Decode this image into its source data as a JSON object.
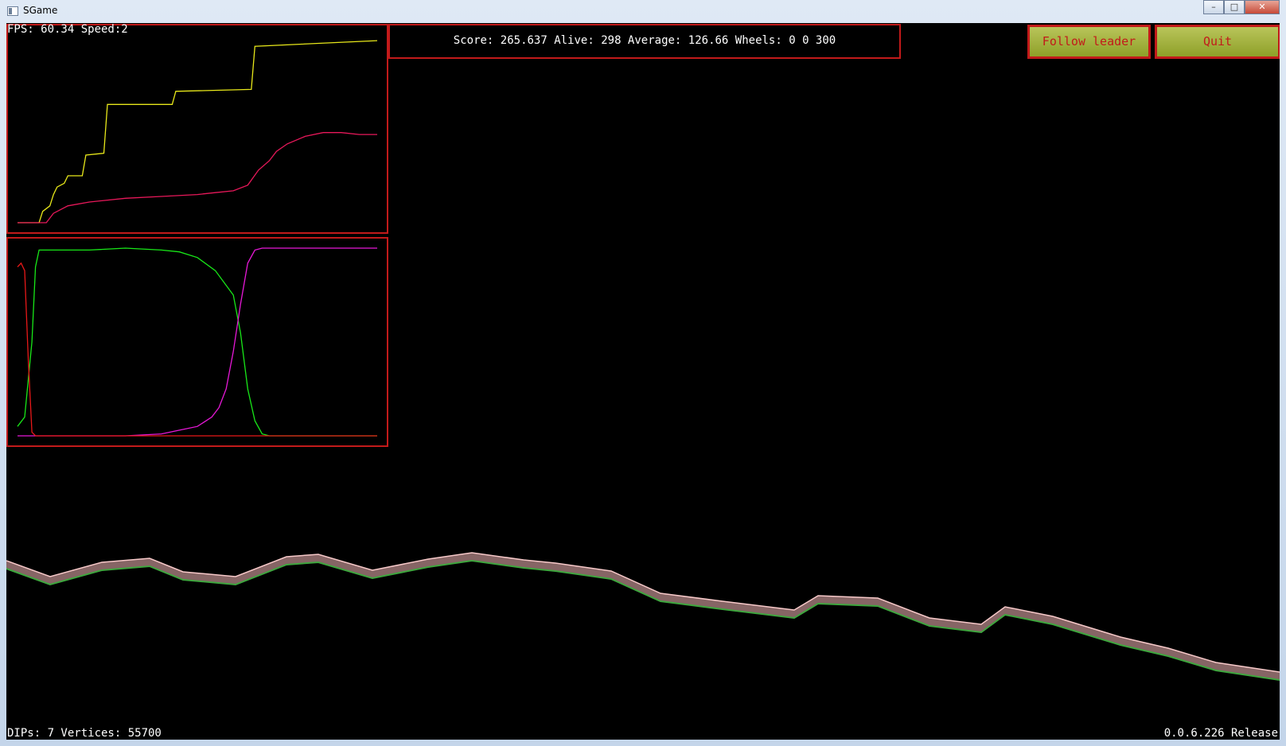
{
  "window": {
    "title": "SGame",
    "minimize_icon": "minimize-icon",
    "maximize_icon": "maximize-icon",
    "close_icon": "close-icon"
  },
  "hud": {
    "fps_text": "FPS: 60.34 Speed:2",
    "score_text": "Score: 265.637 Alive: 298 Average: 126.66 Wheels: 0 0 300",
    "dips_text": "DIPs: 7 Vertices: 55700",
    "version_text": "0.0.6.226 Release"
  },
  "buttons": {
    "follow_leader": "Follow leader",
    "quit": "Quit"
  },
  "colors": {
    "panel_border": "#c21a1a",
    "button_bg": "#a3b43c",
    "button_text": "#c21a1a",
    "max_score_line": "#e8e81a",
    "avg_score_line": "#e8185a",
    "wheels_green": "#18e818",
    "wheels_magenta": "#e818d8",
    "wheels_red": "#e81818",
    "terrain_fill": "#f4b8b8",
    "terrain_edge": "#3ea63e"
  },
  "chart_data": [
    {
      "type": "line",
      "series": [
        {
          "color": "#e8e81a",
          "x": [
            0,
            6,
            7,
            9,
            10,
            11,
            13,
            14,
            18,
            19,
            24,
            25,
            43,
            44,
            65,
            66,
            100
          ],
          "values": [
            0,
            0,
            6,
            9,
            15,
            19,
            21,
            25,
            25,
            36,
            37,
            63,
            63,
            70,
            71,
            94,
            97
          ]
        },
        {
          "color": "#e8185a",
          "x": [
            0,
            8,
            10,
            14,
            20,
            30,
            40,
            50,
            55,
            60,
            64,
            67,
            70,
            72,
            75,
            80,
            85,
            90,
            95,
            100
          ],
          "values": [
            0,
            0,
            5,
            9,
            11,
            13,
            14,
            15,
            16,
            17,
            20,
            28,
            33,
            38,
            42,
            46,
            48,
            48,
            47,
            47
          ]
        }
      ]
    },
    {
      "type": "line",
      "series": [
        {
          "color": "#18e818",
          "x": [
            0,
            2,
            4,
            5,
            6,
            10,
            20,
            30,
            40,
            45,
            50,
            55,
            60,
            62,
            64,
            66,
            68,
            70,
            100
          ],
          "values": [
            5,
            10,
            50,
            90,
            99,
            99,
            99,
            100,
            99,
            98,
            95,
            88,
            75,
            55,
            25,
            8,
            1,
            0,
            0
          ]
        },
        {
          "color": "#e818d8",
          "x": [
            0,
            30,
            40,
            45,
            50,
            54,
            56,
            58,
            60,
            62,
            64,
            66,
            68,
            70,
            100
          ],
          "values": [
            0,
            0,
            1,
            3,
            5,
            10,
            15,
            25,
            45,
            70,
            92,
            99,
            100,
            100,
            100
          ],
          "_start": 0
        },
        {
          "color": "#e81818",
          "x": [
            0,
            1,
            2,
            3,
            4,
            5,
            100
          ],
          "values": [
            90,
            92,
            88,
            40,
            2,
            0,
            0
          ]
        }
      ]
    }
  ]
}
